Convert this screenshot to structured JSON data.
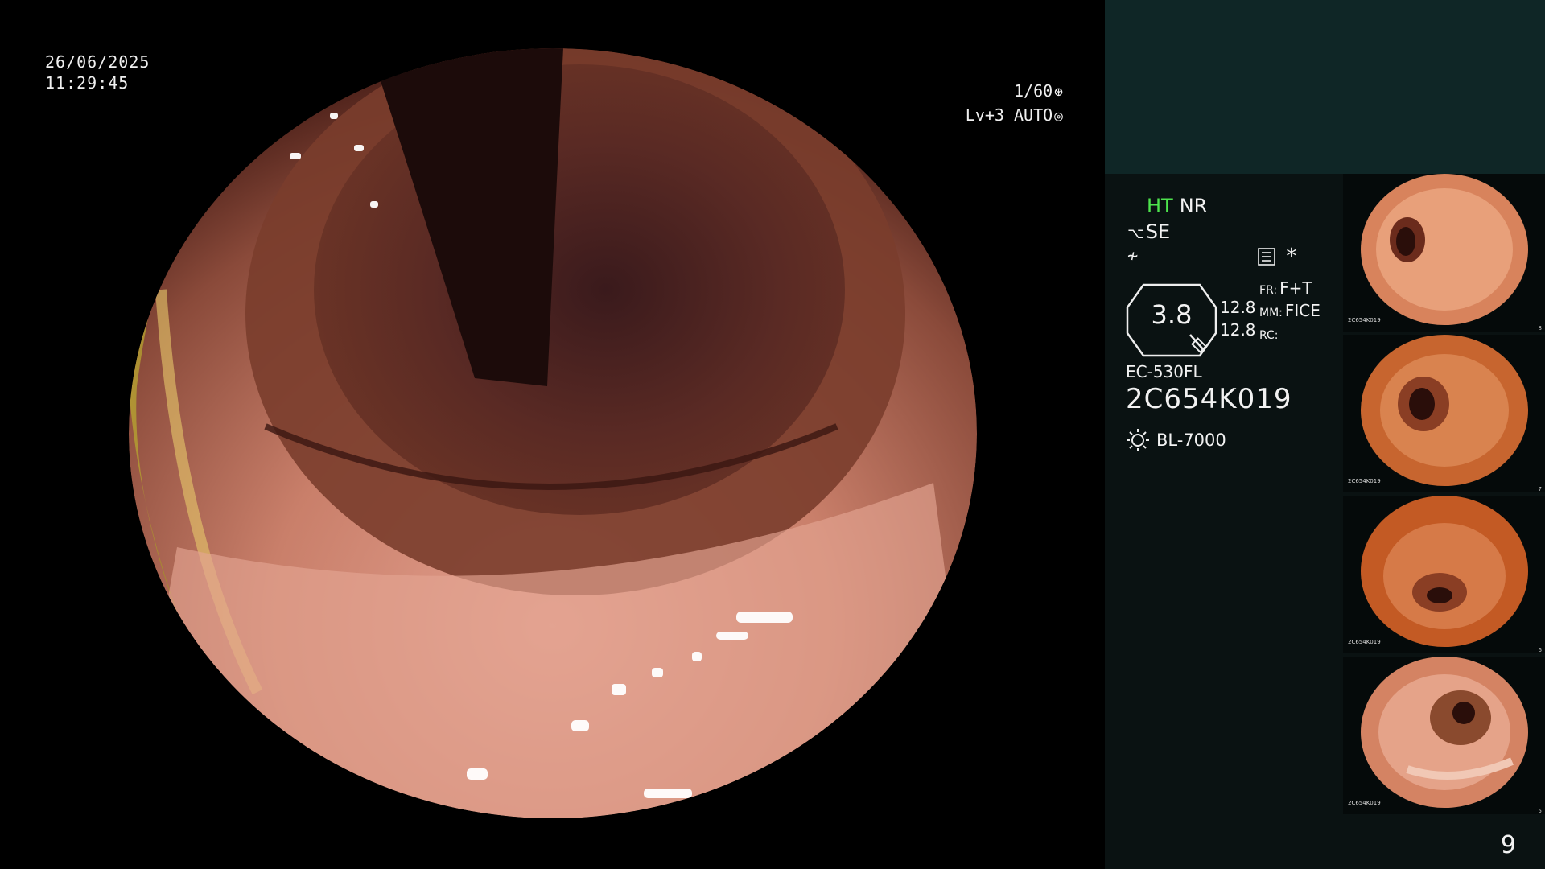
{
  "overlay": {
    "date": "26/06/2025",
    "time": "11:29:45",
    "shutter": "1/60",
    "shutter_glyph": "⊛",
    "iris": "Lv+3 AUTO",
    "iris_glyph": "◎"
  },
  "settings": {
    "ht": "HT",
    "nr": "NR",
    "se": "SE",
    "se_symbol": "⌥",
    "neq_symbol": "≁",
    "star": "*",
    "zoom_value": "3.8",
    "val_1": "12.8",
    "val_2": "12.8",
    "fr_label": "FR:",
    "fr_value": "F+T",
    "mm_label": "MM:",
    "mm_value": "FICE",
    "rc_label": "RC:",
    "rc_value": ""
  },
  "device": {
    "model": "EC-530FL",
    "serial": "2C654K019",
    "light_source": "BL-7000"
  },
  "thumbnails": [
    {
      "caption": "2C654K019",
      "number": "8"
    },
    {
      "caption": "2C654K019",
      "number": "7"
    },
    {
      "caption": "2C654K019",
      "number": "6"
    },
    {
      "caption": "2C654K019",
      "number": "5"
    }
  ],
  "page_number": "9",
  "colors": {
    "sidebar_bg": "#0a1212",
    "top_strip": "#0f2626",
    "ht_green": "#4de34d",
    "mucosa": "#c9826e"
  }
}
